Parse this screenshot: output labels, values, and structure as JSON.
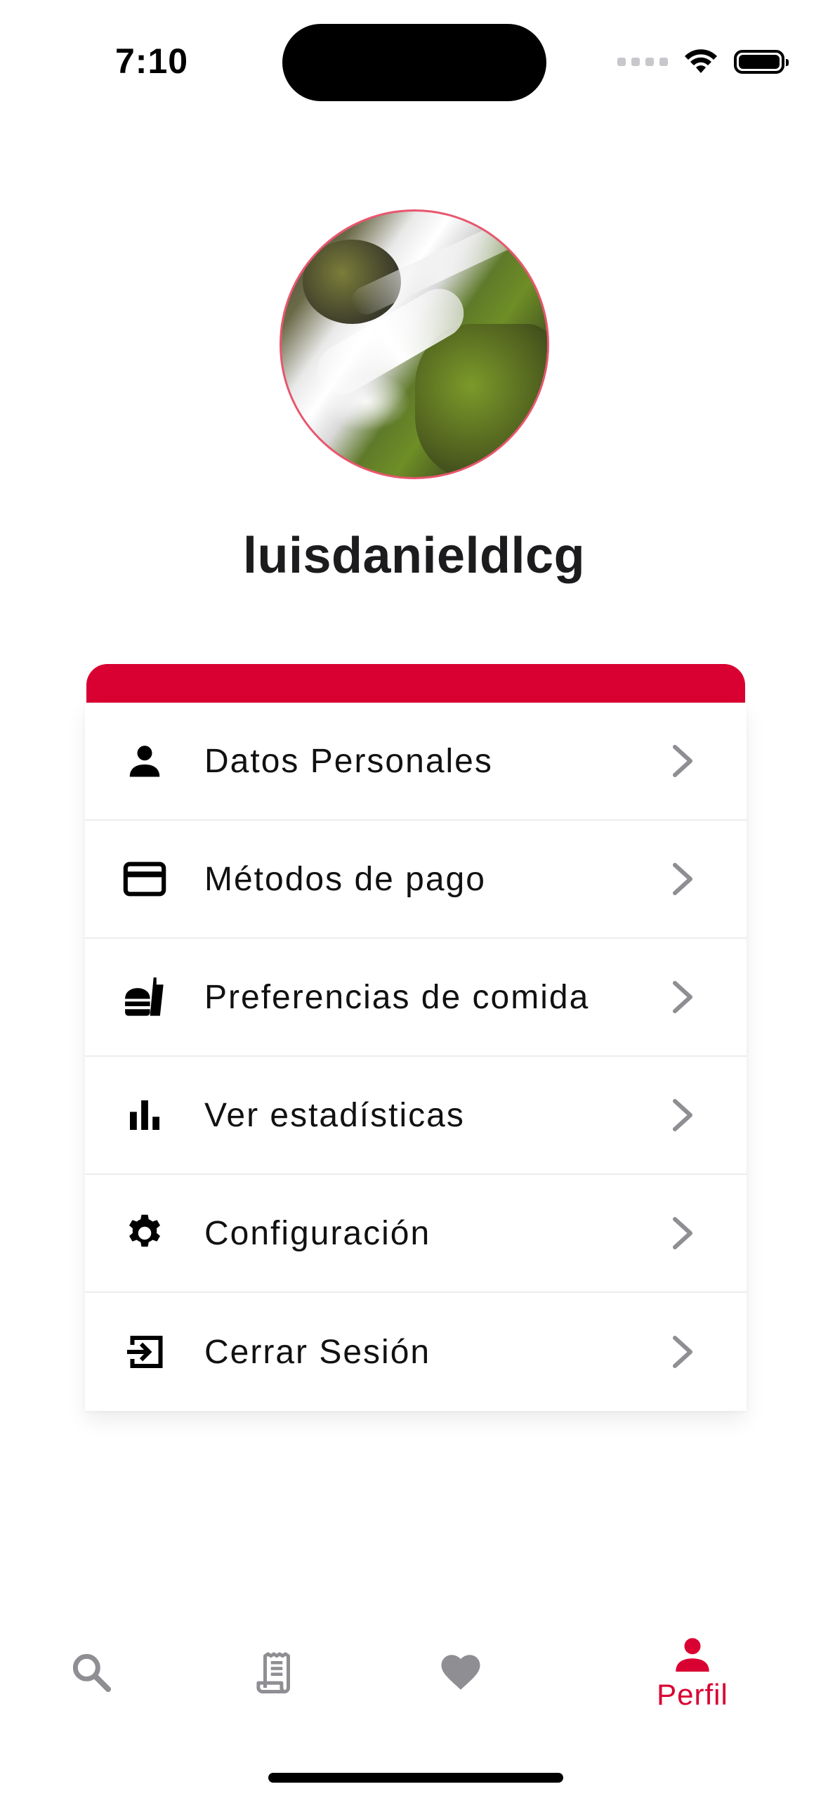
{
  "status_bar": {
    "time": "7:10"
  },
  "profile": {
    "username": "luisdanieldlcg"
  },
  "menu": {
    "items": [
      {
        "label": "Datos Personales",
        "icon": "person-icon"
      },
      {
        "label": "Métodos de pago",
        "icon": "credit-card-icon"
      },
      {
        "label": "Preferencias de comida",
        "icon": "fastfood-icon"
      },
      {
        "label": "Ver estadísticas",
        "icon": "bar-chart-icon"
      },
      {
        "label": "Configuración",
        "icon": "gear-icon"
      },
      {
        "label": "Cerrar Sesión",
        "icon": "logout-icon"
      }
    ]
  },
  "tabbar": {
    "tabs": [
      {
        "icon": "search-icon",
        "active": false
      },
      {
        "icon": "receipt-icon",
        "active": false
      },
      {
        "icon": "heart-icon",
        "active": false
      },
      {
        "icon": "person-icon",
        "label": "Perfil",
        "active": true
      }
    ]
  },
  "colors": {
    "accent": "#d90032",
    "inactive_icon": "#8e8e93",
    "avatar_border": "#e8566e"
  }
}
